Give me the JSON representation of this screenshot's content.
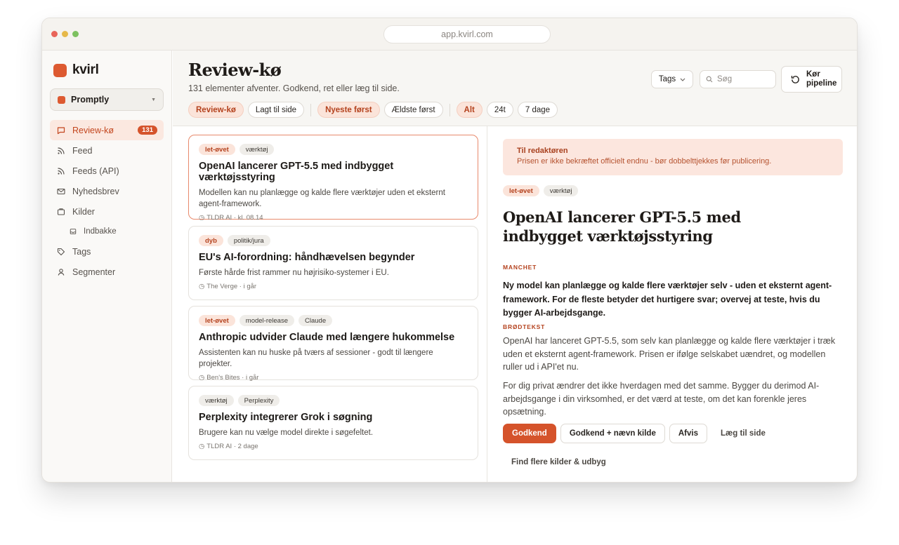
{
  "browser": {
    "url": "app.kvirl.com",
    "dot_colors": [
      "#e8655a",
      "#e6b94a",
      "#7dc160"
    ]
  },
  "brand": {
    "name": "kvirl",
    "accent": "#dd5a31"
  },
  "workspace": {
    "name": "Promptly"
  },
  "sidebar": {
    "items": [
      {
        "label": "Review-kø",
        "icon": "inbox-icon",
        "badge": "131",
        "active": true
      },
      {
        "label": "Feed",
        "icon": "rss-icon"
      },
      {
        "label": "Feeds (API)",
        "icon": "rss-api-icon"
      },
      {
        "label": "Nyhedsbrev",
        "icon": "mail-icon"
      },
      {
        "label": "Kilder",
        "icon": "folder-icon"
      },
      {
        "label": "Indbakke",
        "icon": "tray-icon",
        "sub": true
      },
      {
        "label": "Tags",
        "icon": "tag-icon"
      },
      {
        "label": "Segmenter",
        "icon": "person-icon"
      }
    ]
  },
  "header": {
    "title": "Review-kø",
    "subtitle": "131 elementer afventer. Godkend, ret eller læg til side.",
    "filters_view": [
      "Review-kø",
      "Lagt til side"
    ],
    "filters_sort": [
      "Nyeste først",
      "Ældste først"
    ],
    "filters_time": [
      "Alt",
      "24t",
      "7 dage"
    ],
    "tags_label": "Tags",
    "search_placeholder": "Søg",
    "run_line1": "Kør",
    "run_line2": "pipeline"
  },
  "items": [
    {
      "tags": [
        "let-øvet",
        "værktøj"
      ],
      "title": "OpenAI lancerer GPT-5.5 med indbygget værktøjsstyring",
      "desc": "Modellen kan nu planlægge og kalde flere værktøjer uden et eksternt agent-framework.",
      "meta": "TLDR AI · kl. 08.14"
    },
    {
      "tags": [
        "dyb",
        "politik/jura"
      ],
      "title": "EU's AI-forordning: håndhævelsen begynder",
      "desc": "Første hårde frist rammer nu højrisiko-systemer i EU.",
      "meta": "The Verge · i går"
    },
    {
      "tags": [
        "let-øvet",
        "model-release",
        "Claude"
      ],
      "title": "Anthropic udvider Claude med længere hukommelse",
      "desc": "Assistenten kan nu huske på tværs af sessioner - godt til længere projekter.",
      "meta": "Ben's Bites · i går"
    },
    {
      "tags": [
        "værktøj",
        "Perplexity"
      ],
      "title": "Perplexity integrerer Grok i søgning",
      "desc": "Brugere kan nu vælge model direkte i søgefeltet.",
      "meta": "TLDR AI · 2 dage"
    }
  ],
  "detail": {
    "note_title": "Til redaktøren",
    "note_text": "Prisen er ikke bekræftet officielt endnu - bør dobbelttjekkes før publicering.",
    "tags": [
      "let-øvet",
      "værktøj"
    ],
    "title": "OpenAI lancerer GPT-5.5 med indbygget værktøjsstyring",
    "manchet_label": "MANCHET",
    "manchet": "Ny model kan planlægge og kalde flere værktøjer selv - uden et eksternt agent-framework. For de fleste betyder det hurtigere svar; overvej at teste, hvis du bygger AI-arbejdsgange.",
    "body_label": "BRØDTEKST",
    "body_p1": "OpenAI har lanceret GPT-5.5, som selv kan planlægge og kalde flere værktøjer i træk uden et eksternt agent-framework. Prisen er ifølge selskabet uændret, og modellen ruller ud i API'et nu.",
    "body_p2": "For dig privat ændrer det ikke hverdagen med det samme. Bygger du derimod AI-arbejdsgange i din virksomhed, er det værd at teste, om det kan forenkle jeres opsætning.",
    "actions": {
      "approve": "Godkend",
      "approve_source": "Godkend + nævn kilde",
      "reject": "Afvis",
      "set_aside": "Læg til side"
    },
    "more_link": "Find flere kilder & udbyg"
  }
}
